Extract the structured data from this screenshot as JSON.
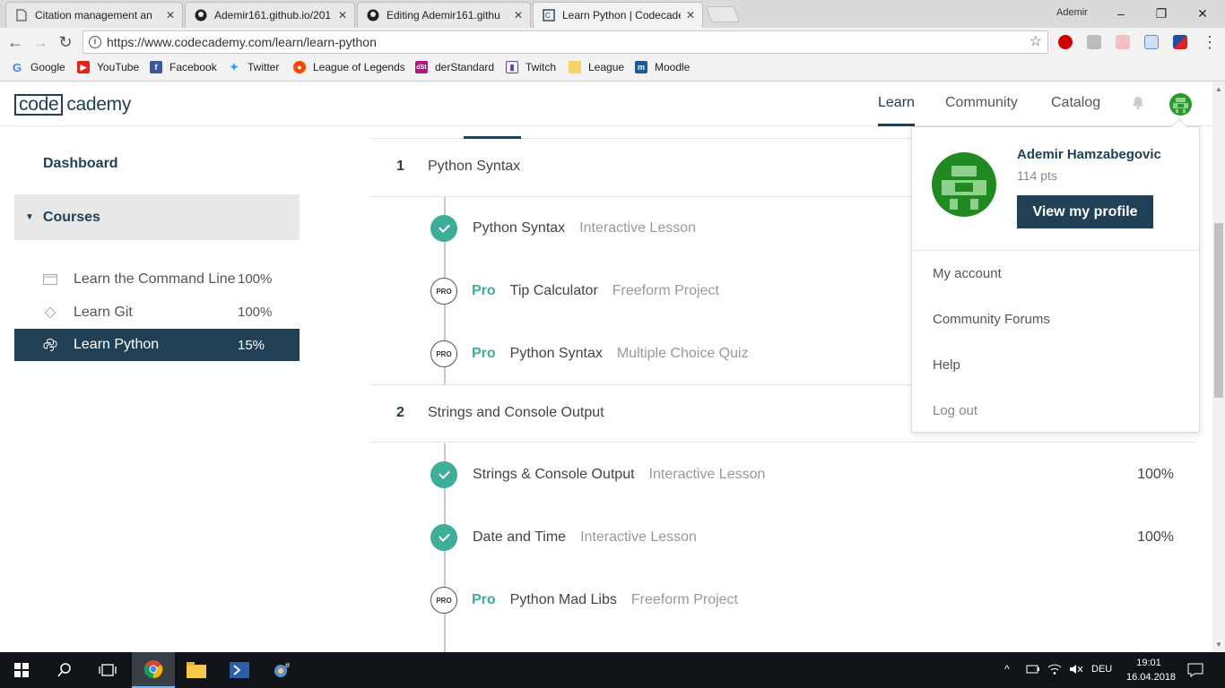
{
  "browser": {
    "tabs": [
      {
        "title": "Citation management an",
        "icon": "document-icon"
      },
      {
        "title": "Ademir161.github.io/201",
        "icon": "github-icon"
      },
      {
        "title": "Editing Ademir161.githu",
        "icon": "github-icon"
      },
      {
        "title": "Learn Python | Codecade",
        "icon": "codecademy-icon"
      }
    ],
    "window_user": "Ademir",
    "url": "https://www.codecademy.com/learn/learn-python",
    "bookmarks": [
      {
        "label": "Google",
        "icon": "google-icon",
        "color": "#4285f4"
      },
      {
        "label": "YouTube",
        "icon": "youtube-icon",
        "color": "#e62117"
      },
      {
        "label": "Facebook",
        "icon": "facebook-icon",
        "color": "#3b5998"
      },
      {
        "label": "Twitter",
        "icon": "twitter-icon",
        "color": "#1da1f2"
      },
      {
        "label": "League of Legends",
        "icon": "reddit-icon",
        "color": "#ff4500"
      },
      {
        "label": "derStandard",
        "icon": "derstandard-icon",
        "color": "#b0187e"
      },
      {
        "label": "Twitch",
        "icon": "twitch-icon",
        "color": "#6441a5"
      },
      {
        "label": "League",
        "icon": "folder-icon",
        "color": "#f6d365"
      },
      {
        "label": "Moodle",
        "icon": "moodle-icon",
        "color": "#1e5a96"
      }
    ]
  },
  "site": {
    "logo_box": "code",
    "logo_rest": "cademy",
    "nav": [
      "Learn",
      "Community",
      "Catalog"
    ],
    "accent": "#204056",
    "green": "#3dae97"
  },
  "sidebar": {
    "dashboard": "Dashboard",
    "courses_label": "Courses",
    "courses": [
      {
        "name": "Learn the Command Line",
        "pct": "100%",
        "icon": "terminal-icon"
      },
      {
        "name": "Learn Git",
        "pct": "100%",
        "icon": "git-icon"
      },
      {
        "name": "Learn Python",
        "pct": "15%",
        "icon": "python-icon"
      }
    ]
  },
  "syllabus": {
    "sections": [
      {
        "num": "1",
        "title": "Python Syntax",
        "lessons": [
          {
            "status": "done",
            "pro": "",
            "name": "Python Syntax",
            "type": "Interactive Lesson",
            "pct": ""
          },
          {
            "status": "pro",
            "pro": "Pro",
            "name": "Tip Calculator",
            "type": "Freeform Project",
            "pct": ""
          },
          {
            "status": "pro",
            "pro": "Pro",
            "name": "Python Syntax",
            "type": "Multiple Choice Quiz",
            "pct": ""
          }
        ]
      },
      {
        "num": "2",
        "title": "Strings and Console Output",
        "lessons": [
          {
            "status": "done",
            "pro": "",
            "name": "Strings & Console Output",
            "type": "Interactive Lesson",
            "pct": "100%"
          },
          {
            "status": "done",
            "pro": "",
            "name": "Date and Time",
            "type": "Interactive Lesson",
            "pct": "100%"
          },
          {
            "status": "pro",
            "pro": "Pro",
            "name": "Python Mad Libs",
            "type": "Freeform Project",
            "pct": ""
          }
        ]
      }
    ],
    "pro_badge": "PRO"
  },
  "dropdown": {
    "name": "Ademir Hamzabegovic",
    "points": "114 pts",
    "view_profile": "View my profile",
    "items": [
      "My account",
      "Community Forums",
      "Help",
      "Log out"
    ]
  },
  "taskbar": {
    "language": "DEU",
    "time": "19:01",
    "date": "16.04.2018"
  }
}
